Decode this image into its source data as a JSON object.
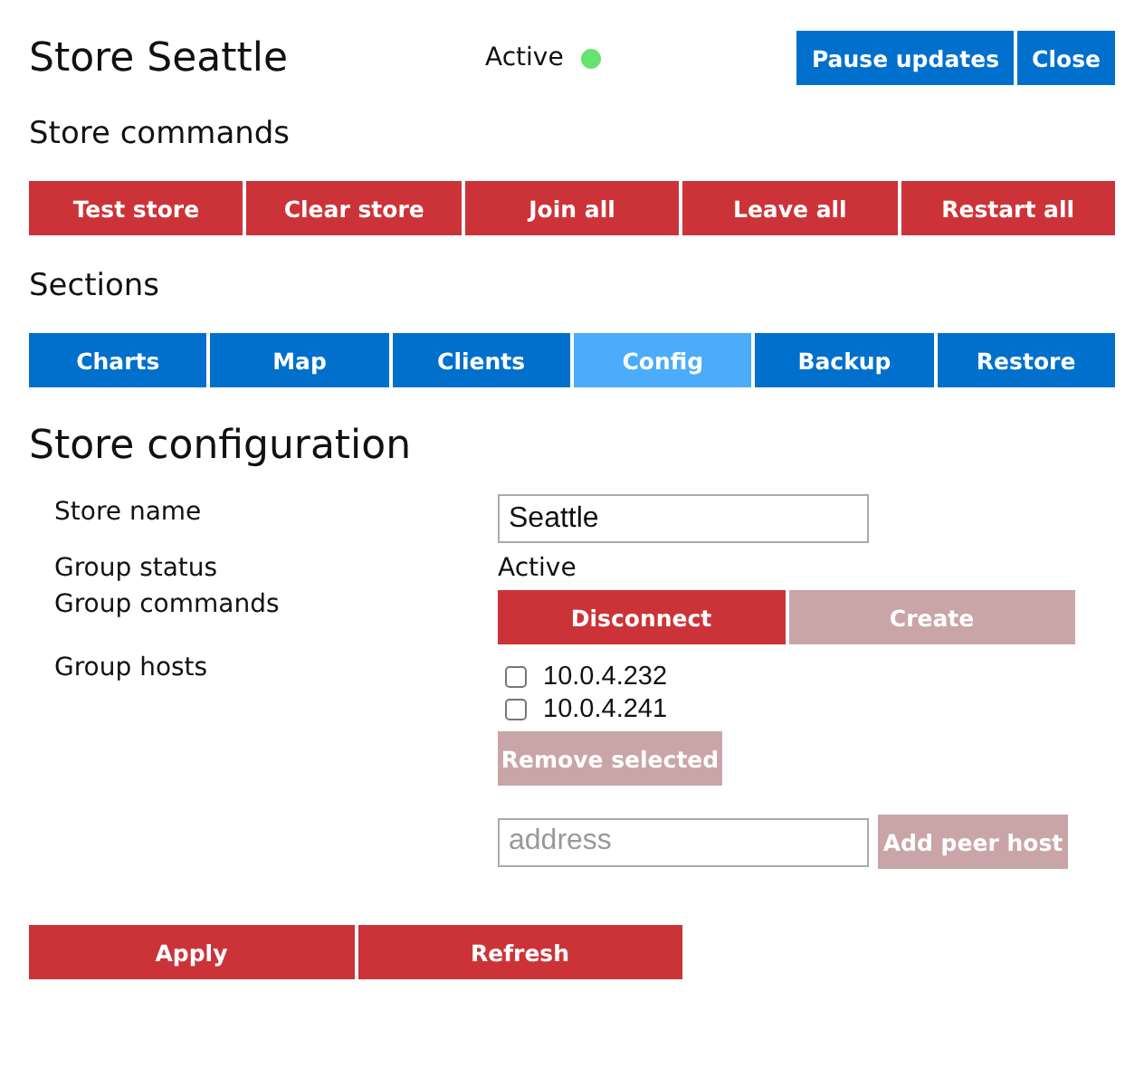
{
  "header": {
    "title": "Store Seattle",
    "status": {
      "label": "Active",
      "color": "#66e26f"
    },
    "buttons": [
      {
        "label": "Pause updates"
      },
      {
        "label": "Close"
      }
    ]
  },
  "store_commands": {
    "heading": "Store commands",
    "buttons": [
      {
        "label": "Test store"
      },
      {
        "label": "Clear store"
      },
      {
        "label": "Join all"
      },
      {
        "label": "Leave all"
      },
      {
        "label": "Restart all"
      }
    ]
  },
  "sections": {
    "heading": "Sections",
    "tabs": [
      {
        "label": "Charts",
        "selected": false
      },
      {
        "label": "Map",
        "selected": false
      },
      {
        "label": "Clients",
        "selected": false
      },
      {
        "label": "Config",
        "selected": true
      },
      {
        "label": "Backup",
        "selected": false
      },
      {
        "label": "Restore",
        "selected": false
      }
    ]
  },
  "config": {
    "heading": "Store configuration",
    "store_name": {
      "label": "Store name",
      "value": "Seattle"
    },
    "group_status": {
      "label": "Group status",
      "value": "Active"
    },
    "group_commands": {
      "label": "Group commands",
      "buttons": [
        {
          "label": "Disconnect",
          "disabled": false
        },
        {
          "label": "Create",
          "disabled": true
        }
      ]
    },
    "group_hosts": {
      "label": "Group hosts",
      "hosts": [
        {
          "address": "10.0.4.232",
          "checked": false
        },
        {
          "address": "10.0.4.241",
          "checked": false
        }
      ],
      "remove_button": {
        "label": "Remove selected",
        "disabled": true
      },
      "address_field": {
        "placeholder": "address"
      },
      "add_button": {
        "label": "Add peer host",
        "disabled": true
      }
    }
  },
  "footer_buttons": [
    {
      "label": "Apply",
      "disabled": false
    },
    {
      "label": "Refresh",
      "disabled": false
    }
  ]
}
